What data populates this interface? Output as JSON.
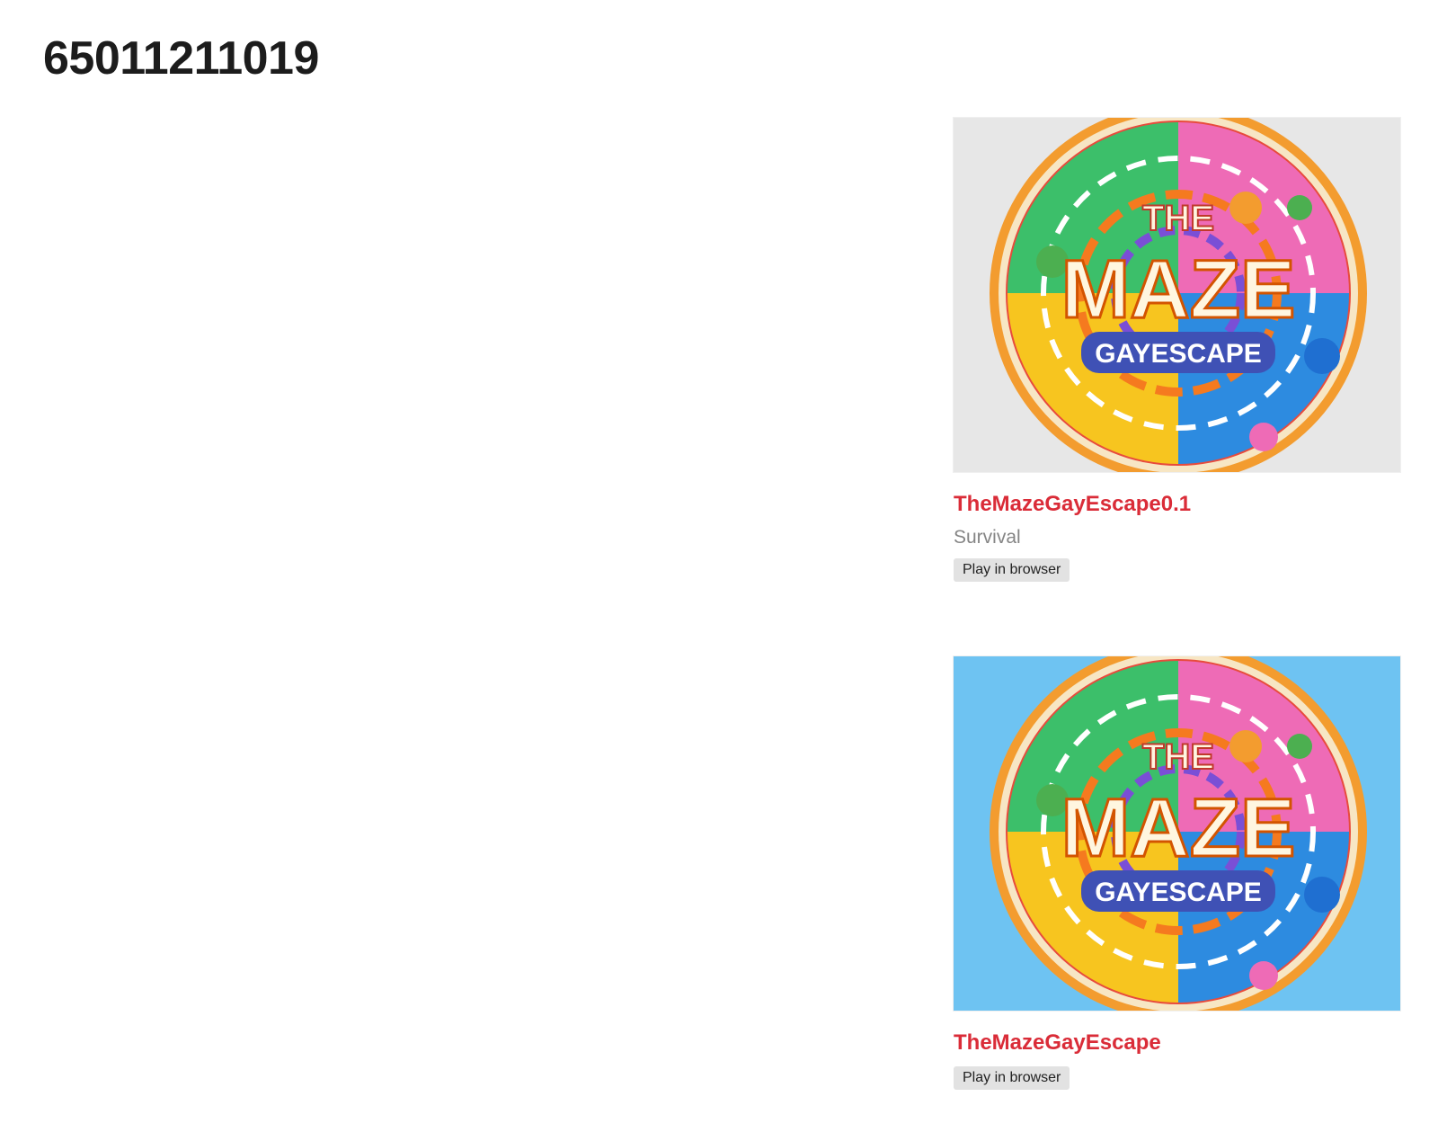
{
  "page": {
    "title": "65011211019"
  },
  "games": [
    {
      "title": "TheMazeGayEscape0.1",
      "genre": "Survival",
      "platform_label": "Play in browser",
      "thumbnail": {
        "background": "#e7e7e7",
        "logo_top": "THE",
        "logo_main": "MAZE",
        "logo_sub": "GAYESCAPE"
      }
    },
    {
      "title": "TheMazeGayEscape",
      "platform_label": "Play in browser",
      "thumbnail": {
        "background": "#6ec3f2",
        "logo_top": "THE",
        "logo_main": "MAZE",
        "logo_sub": "GAYESCAPE"
      }
    }
  ],
  "colors": {
    "title_link": "#da2c38",
    "genre_text": "#858585",
    "tag_background": "#e2e2e2"
  }
}
